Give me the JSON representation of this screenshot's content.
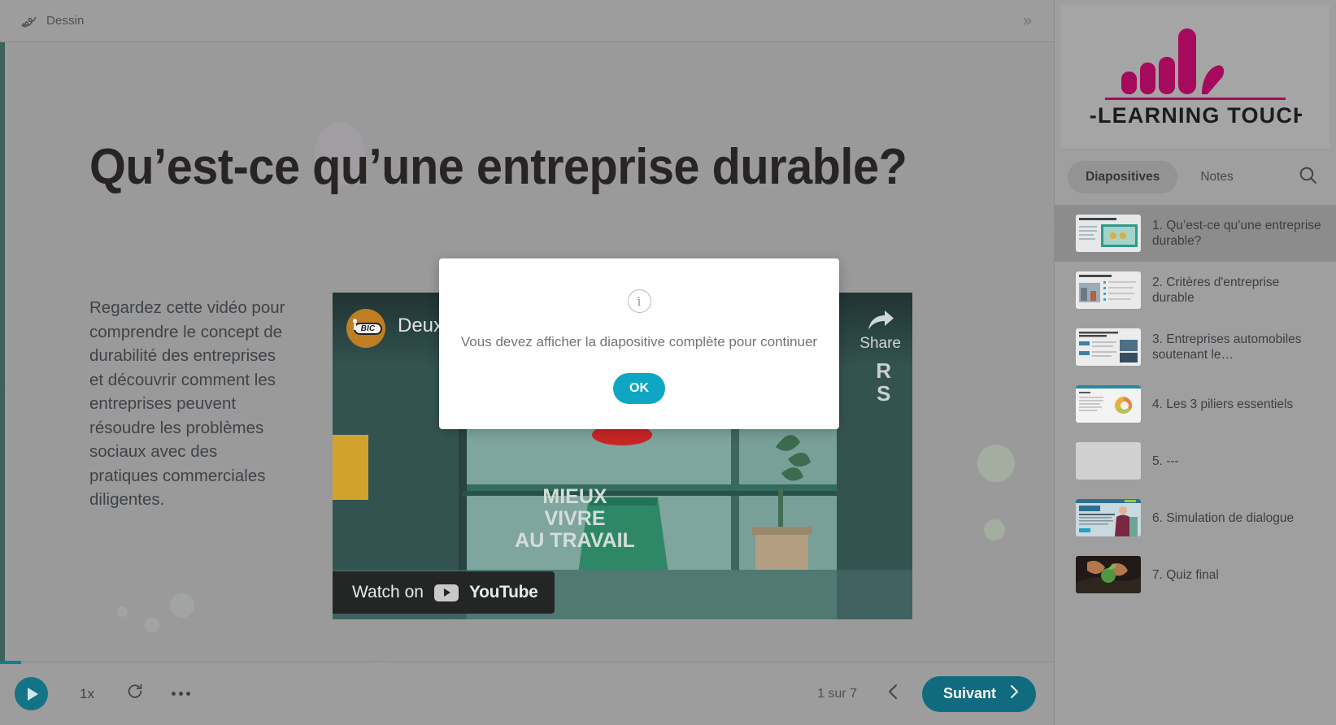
{
  "topbar": {
    "drawing_label": "Dessin",
    "drawing_icon": "scribble-icon",
    "expand_icon": "»"
  },
  "slide": {
    "title": "Qu’est-ce qu’une entreprise durable?",
    "body": "Regardez cette vidéo pour comprendre le concept de durabilité des entreprises et découvrir comment les entreprises peuvent résoudre les problèmes sociaux avec des pratiques commerciales diligentes."
  },
  "video": {
    "channel_logo_text": "BIC",
    "title": "Deux m",
    "share_label": "Share",
    "side_text": "R\nS",
    "podium_text": "MIEUX\nVIVRE\nAU TRAVAIL",
    "watch_prefix": "Watch on",
    "platform": "YouTube"
  },
  "playbar": {
    "play_icon": "play-icon",
    "speed": "1x",
    "replay_icon": "replay-icon",
    "more_icon": "more-options-icon",
    "counter": "1 sur 7",
    "prev_icon": "chevron-left-icon",
    "next_label": "Suivant",
    "next_icon": "chevron-right-icon"
  },
  "sidebar": {
    "logo_text": "E-LEARNING TOUCH’",
    "logo_color": "#A9045C",
    "tabs": [
      {
        "label": "Diapositives",
        "active": true
      },
      {
        "label": "Notes",
        "active": false
      }
    ],
    "search_icon": "search-icon",
    "slides": [
      {
        "label": "1. Qu’est-ce qu’une entreprise durable?",
        "active": true,
        "thumb": "title-video-slide"
      },
      {
        "label": "2. Critères d'entreprise durable",
        "active": false,
        "thumb": "criteria-slide"
      },
      {
        "label": "3. Entreprises automobiles soutenant le…",
        "active": false,
        "thumb": "automobile-slide"
      },
      {
        "label": "4. Les 3 piliers essentiels",
        "active": false,
        "thumb": "donut-chart-slide"
      },
      {
        "label": "5. ---",
        "active": false,
        "thumb": "blank-slide"
      },
      {
        "label": "6. Simulation de dialogue",
        "active": false,
        "thumb": "dialogue-slide"
      },
      {
        "label": "7. Quiz final",
        "active": false,
        "thumb": "quiz-slide"
      }
    ]
  },
  "modal": {
    "icon": "info-icon",
    "message": "Vous devez afficher la diapositive complète pour continuer",
    "ok_label": "OK"
  },
  "colors": {
    "accent_teal": "#0A6B80",
    "modal_button": "#0FA6C4",
    "brand_magenta": "#A9045C",
    "stage_rail": "#39605E"
  }
}
